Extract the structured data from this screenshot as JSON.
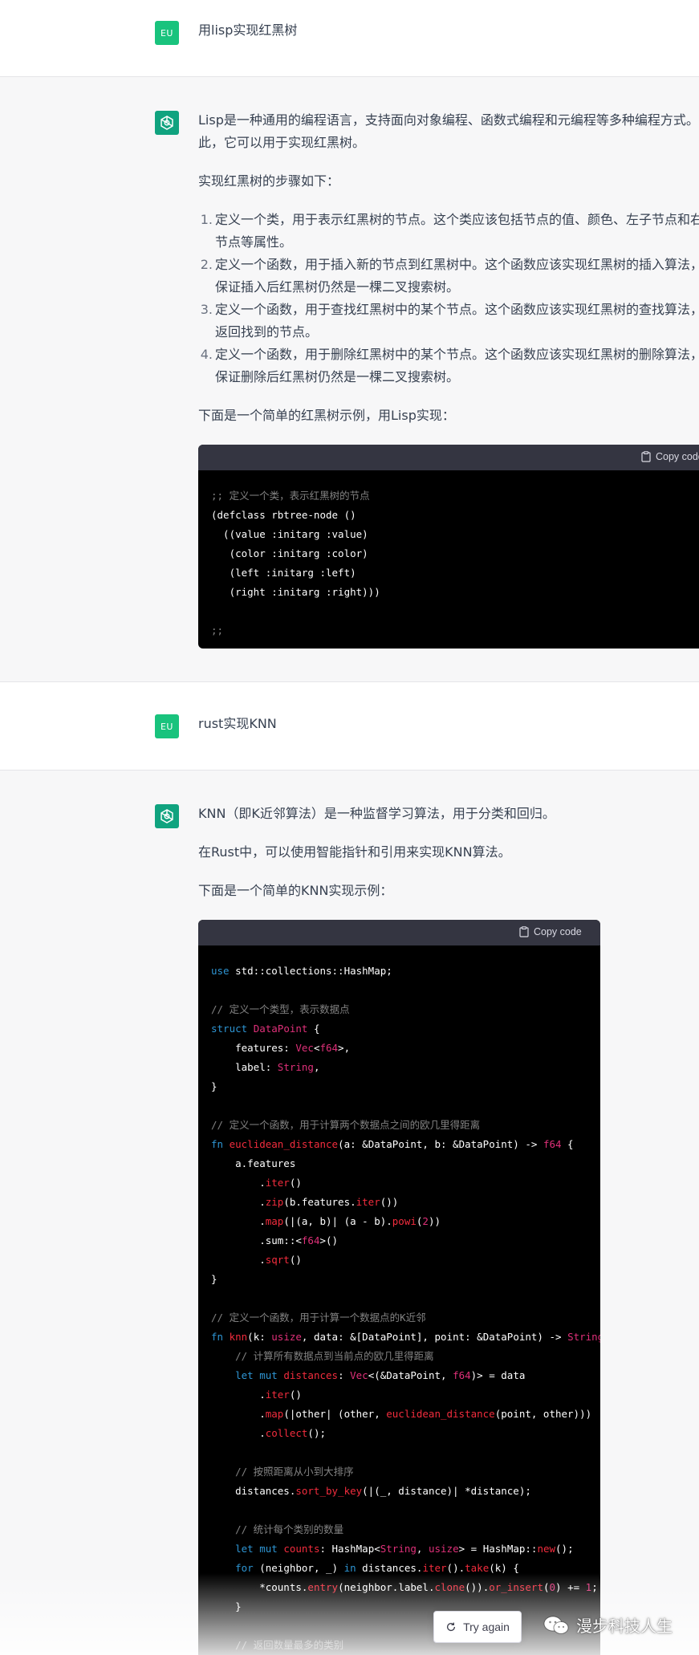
{
  "conversation": [
    {
      "role": "user",
      "avatar_label": "EU",
      "text": "用lisp实现红黑树"
    },
    {
      "role": "assistant",
      "intro": "Lisp是一种通用的编程语言，支持面向对象编程、函数式编程和元编程等多种编程方式。",
      "intro_line2": "此，它可以用于实现红黑树。",
      "steps_heading": "实现红黑树的步骤如下：",
      "steps": [
        {
          "num": "1.",
          "line1": "定义一个类，用于表示红黑树的节点。这个类应该包括节点的值、颜色、左子节点和右",
          "line2": "节点等属性。"
        },
        {
          "num": "2.",
          "line1": "定义一个函数，用于插入新的节点到红黑树中。这个函数应该实现红黑树的插入算法，",
          "line2": "保证插入后红黑树仍然是一棵二叉搜索树。"
        },
        {
          "num": "3.",
          "line1": "定义一个函数，用于查找红黑树中的某个节点。这个函数应该实现红黑树的查找算法，",
          "line2": "返回找到的节点。"
        },
        {
          "num": "4.",
          "line1": "定义一个函数，用于删除红黑树中的某个节点。这个函数应该实现红黑树的删除算法，",
          "line2": "保证删除后红黑树仍然是一棵二叉搜索树。"
        }
      ],
      "example_intro": "下面是一个简单的红黑树示例，用Lisp实现：",
      "copy_label": "Copy code",
      "code_lines": [
        ";; 定义一个类，表示红黑树的节点",
        "(defclass rbtree-node ()",
        "  ((value :initarg :value)",
        "   (color :initarg :color)",
        "   (left :initarg :left)",
        "   (right :initarg :right)))",
        "",
        ";;"
      ]
    },
    {
      "role": "user",
      "avatar_label": "EU",
      "text": "rust实现KNN"
    },
    {
      "role": "assistant",
      "para1": "KNN（即K近邻算法）是一种监督学习算法，用于分类和回归。",
      "para2": "在Rust中，可以使用智能指针和引用来实现KNN算法。",
      "para3": "下面是一个简单的KNN实现示例：",
      "copy_label": "Copy code",
      "code_lines": [
        "use std::collections::HashMap;",
        "",
        "// 定义一个类型，表示数据点",
        "struct DataPoint {",
        "    features: Vec<f64>,",
        "    label: String,",
        "}",
        "",
        "// 定义一个函数，用于计算两个数据点之间的欧几里得距离",
        "fn euclidean_distance(a: &DataPoint, b: &DataPoint) -> f64 {",
        "    a.features",
        "        .iter()",
        "        .zip(b.features.iter())",
        "        .map(|(a, b)| (a - b).powi(2))",
        "        .sum::<f64>()",
        "        .sqrt()",
        "}",
        "",
        "// 定义一个函数，用于计算一个数据点的K近邻",
        "fn knn(k: usize, data: &[DataPoint], point: &DataPoint) -> String {",
        "    // 计算所有数据点到当前点的欧几里得距离",
        "    let mut distances: Vec<(&DataPoint, f64)> = data",
        "        .iter()",
        "        .map(|other| (other, euclidean_distance(point, other)))",
        "        .collect();",
        "",
        "    // 按照距离从小到大排序",
        "    distances.sort_by_key(|(_, distance)| *distance);",
        "",
        "    // 统计每个类别的数量",
        "    let mut counts: HashMap<String, usize> = HashMap::new();",
        "    for (neighbor, _) in distances.iter().take(k) {",
        "        *counts.entry(neighbor.label.clone()).or_insert(0) += 1;",
        "    }",
        "",
        "    // 返回数量最多的类别"
      ]
    }
  ],
  "controls": {
    "try_again_label": "Try again"
  },
  "watermark": {
    "text": "漫步科技人生"
  },
  "colors": {
    "user_avatar": "#19c37d",
    "bot_avatar": "#10a37f",
    "code_bg": "#000000",
    "code_header": "#343541",
    "keyword": "#2e95d3",
    "type": "#df3079",
    "function": "#f22c3d",
    "comment": "#808080"
  }
}
